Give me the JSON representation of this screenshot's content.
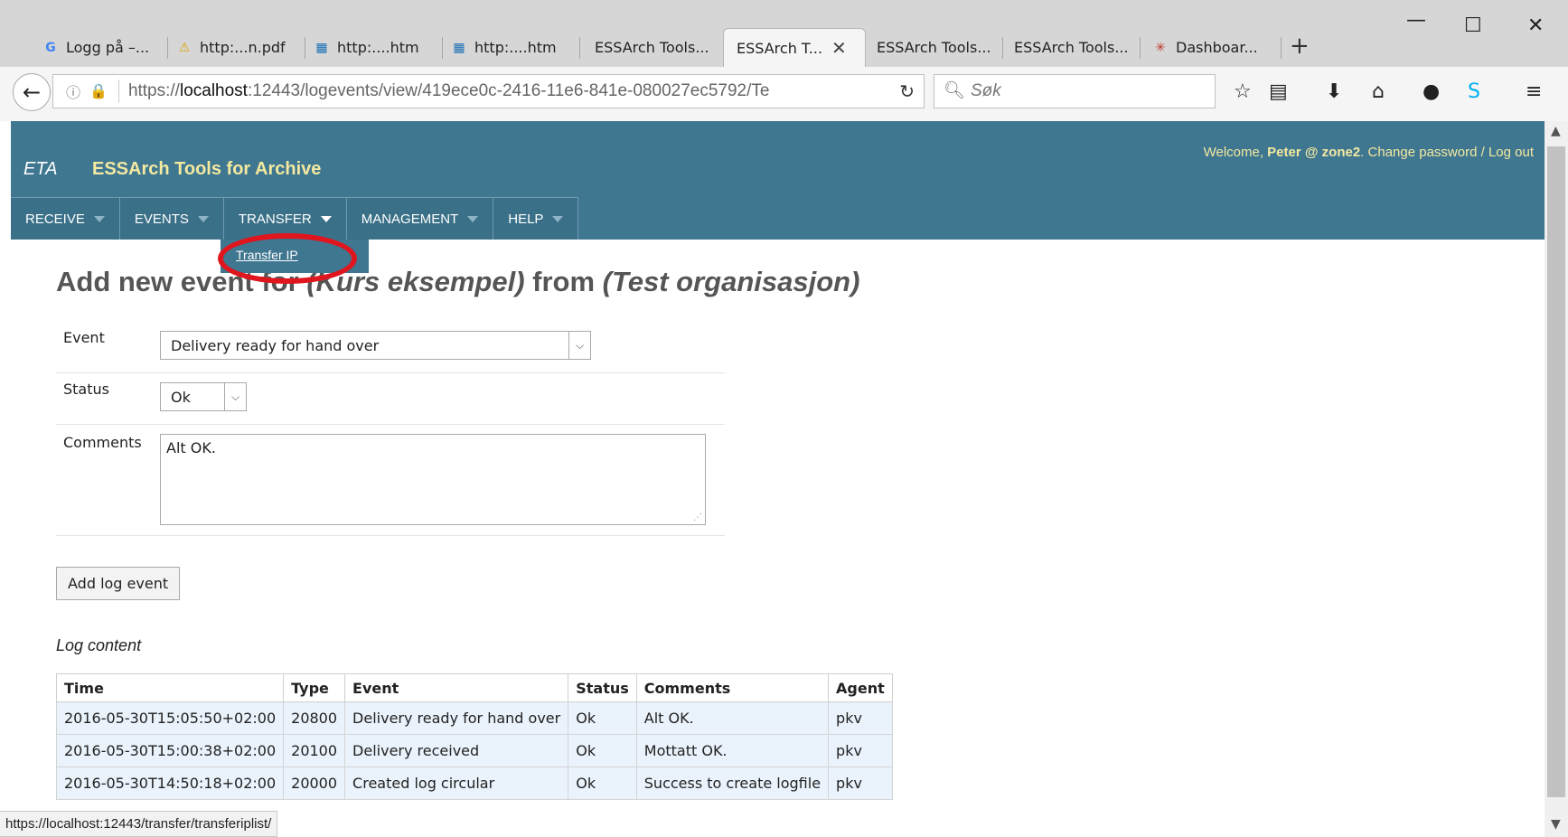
{
  "browser": {
    "tabs": [
      {
        "icon": "google-icon",
        "glyph": "G",
        "label": "Logg på –...",
        "active": false
      },
      {
        "icon": "warning-icon",
        "glyph": "⚠",
        "label": "http:...n.pdf",
        "active": false
      },
      {
        "icon": "cisco-icon",
        "glyph": "▦",
        "label": "http:....htm",
        "active": false
      },
      {
        "icon": "cisco-icon",
        "glyph": "▦",
        "label": "http:....htm",
        "active": false
      },
      {
        "icon": "",
        "glyph": "",
        "label": "ESSArch Tools...",
        "active": false
      },
      {
        "icon": "",
        "glyph": "",
        "label": "ESSArch T...",
        "active": true
      },
      {
        "icon": "",
        "glyph": "",
        "label": "ESSArch Tools...",
        "active": false
      },
      {
        "icon": "",
        "glyph": "",
        "label": "ESSArch Tools...",
        "active": false
      },
      {
        "icon": "dashboard-icon",
        "glyph": "✳",
        "label": "Dashboar...",
        "active": false
      }
    ],
    "url_scheme": "https://",
    "url_host": "localhost",
    "url_rest": ":12443/logevents/view/419ece0c-2416-11e6-841e-080027ec5792/Te",
    "search_placeholder": "Søk",
    "status_url": "https://localhost:12443/transfer/transferiplist/"
  },
  "app": {
    "brand_short": "ETA",
    "brand_name": "ESSArch Tools for Archive",
    "welcome_prefix": "Welcome, ",
    "welcome_user": "Peter @ zone2",
    "welcome_sep": ". ",
    "change_password": "Change password",
    "slash": " / ",
    "logout": "Log out"
  },
  "menu": {
    "receive": "RECEIVE",
    "events": "EVENTS",
    "transfer": "TRANSFER",
    "management": "MANAGEMENT",
    "help": "HELP",
    "dropdown_item": "Transfer IP"
  },
  "form": {
    "title_prefix": "Add new event for ",
    "title_item": "(Kurs eksempel)",
    "title_mid": " from ",
    "title_org": "(Test organisasjon)",
    "event_label": "Event",
    "event_value": "Delivery ready for hand over",
    "status_label": "Status",
    "status_value": "Ok",
    "comments_label": "Comments",
    "comments_value": "Alt OK.",
    "submit_label": "Add log event"
  },
  "log": {
    "title": "Log content",
    "columns": [
      "Time",
      "Type",
      "Event",
      "Status",
      "Comments",
      "Agent"
    ],
    "rows": [
      [
        "2016-05-30T15:05:50+02:00",
        "20800",
        "Delivery ready for hand over",
        "Ok",
        "Alt OK.",
        "pkv"
      ],
      [
        "2016-05-30T15:00:38+02:00",
        "20100",
        "Delivery received",
        "Ok",
        "Mottatt OK.",
        "pkv"
      ],
      [
        "2016-05-30T14:50:18+02:00",
        "20000",
        "Created log circular",
        "Ok",
        "Success to create logfile",
        "pkv"
      ]
    ]
  },
  "colors": {
    "header_bg": "#3f7690",
    "brand_accent": "#f3e9a0",
    "annotation_red": "#e0161e",
    "row_bg": "#eaf2fb"
  }
}
